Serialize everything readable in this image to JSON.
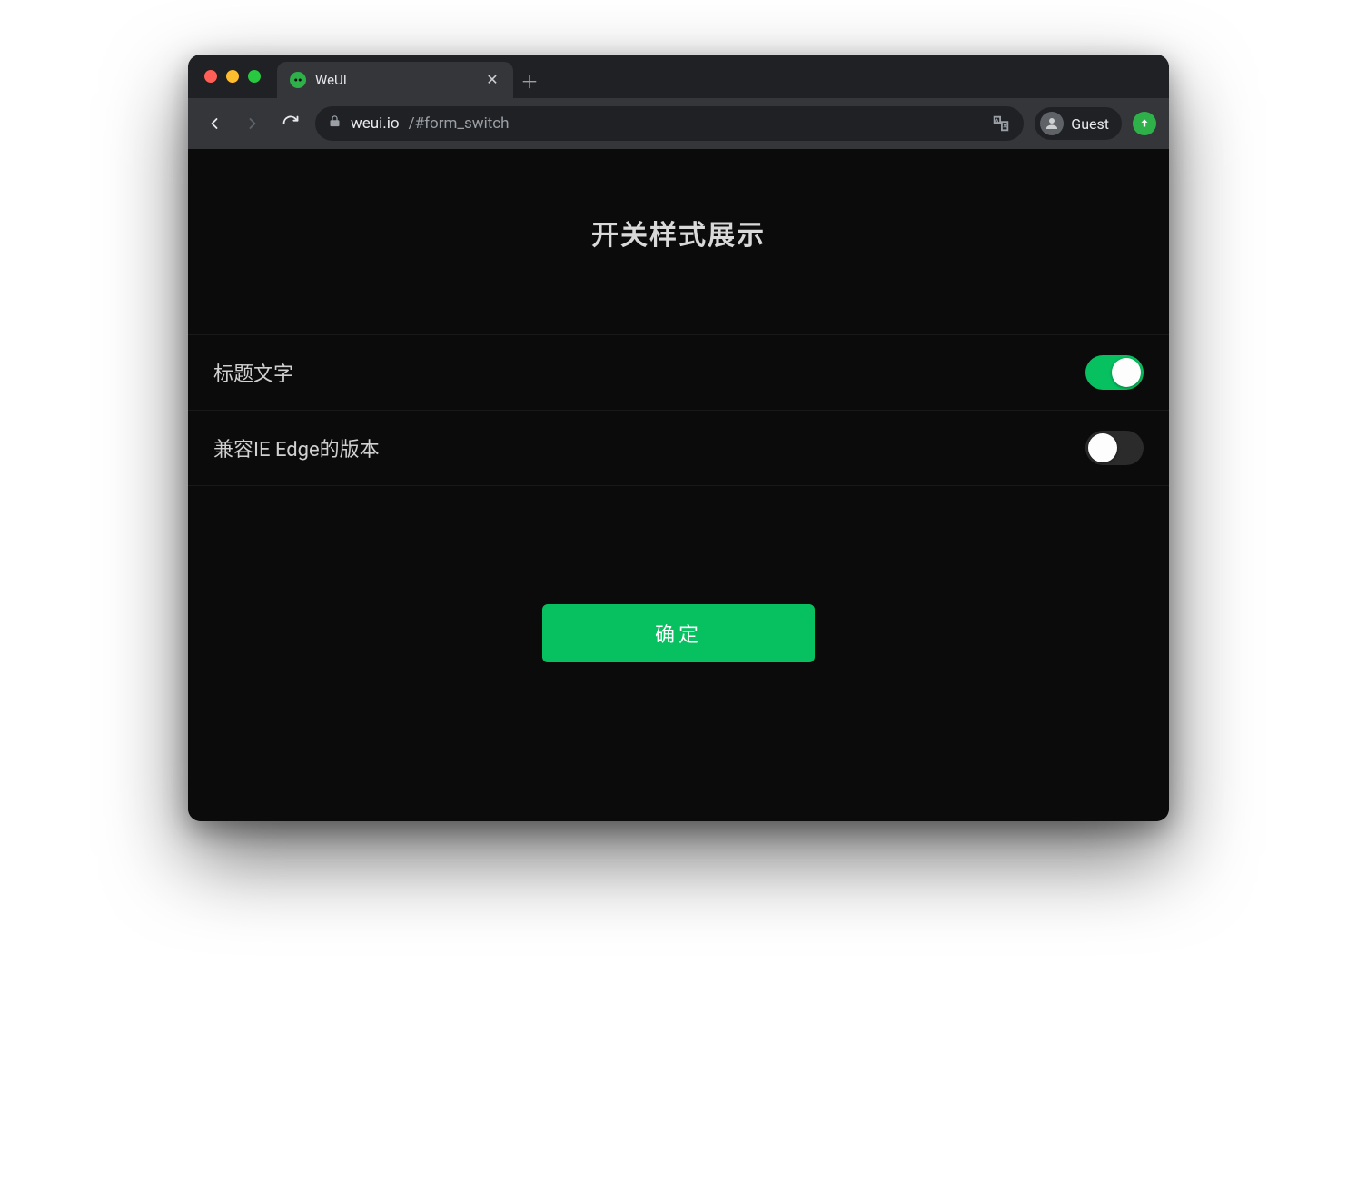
{
  "browser": {
    "tab_title": "WeUI",
    "url_host": "weui.io",
    "url_rest": "/#form_switch",
    "profile_label": "Guest"
  },
  "page": {
    "title": "开关样式展示",
    "cells": [
      {
        "label": "标题文字",
        "on": true
      },
      {
        "label": "兼容IE Edge的版本",
        "on": false
      }
    ],
    "confirm_label": "确定"
  },
  "colors": {
    "accent": "#07c160",
    "bg": "#0b0b0b",
    "chrome_bg": "#202124",
    "toolbar_bg": "#35363a"
  }
}
